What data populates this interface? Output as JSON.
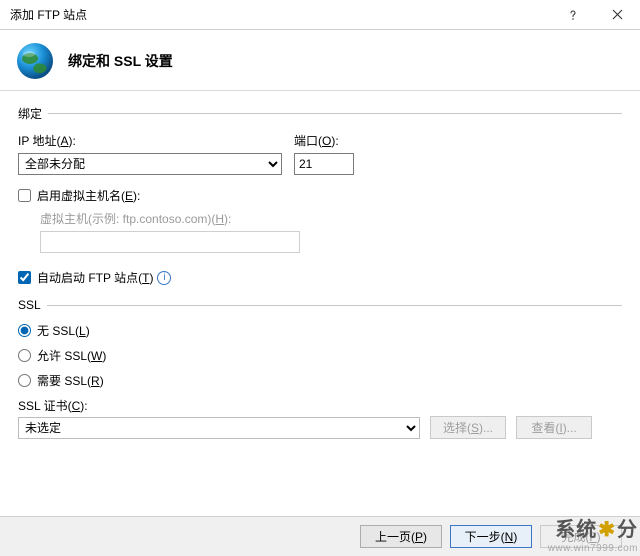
{
  "window": {
    "title": "添加 FTP 站点"
  },
  "header": {
    "title": "绑定和 SSL 设置"
  },
  "binding": {
    "group_label": "绑定",
    "ip_label_pre": "IP 地址(",
    "ip_label_u": "A",
    "ip_label_post": "):",
    "ip_value": "全部未分配",
    "port_label_pre": "端口(",
    "port_label_u": "O",
    "port_label_post": "):",
    "port_value": "21",
    "vhost_label_pre": "启用虚拟主机名(",
    "vhost_label_u": "E",
    "vhost_label_post": "):",
    "vhost_sub_label_pre": "虚拟主机(示例: ftp.contoso.com)(",
    "vhost_sub_label_u": "H",
    "vhost_sub_label_post": "):"
  },
  "autostart": {
    "label_pre": "自动启动 FTP 站点(",
    "label_u": "T",
    "label_post": ")"
  },
  "ssl": {
    "group_label": "SSL",
    "none_pre": "无 SSL(",
    "none_u": "L",
    "none_post": ")",
    "allow_pre": "允许 SSL(",
    "allow_u": "W",
    "allow_post": ")",
    "require_pre": "需要 SSL(",
    "require_u": "R",
    "require_post": ")",
    "cert_label_pre": "SSL 证书(",
    "cert_label_u": "C",
    "cert_label_post": "):",
    "cert_value": "未选定",
    "select_btn_pre": "选择(",
    "select_btn_u": "S",
    "select_btn_post": ")...",
    "view_btn_pre": "查看(",
    "view_btn_u": "I",
    "view_btn_post": ")..."
  },
  "wizard": {
    "prev_pre": "上一页(",
    "prev_u": "P",
    "prev_post": ")",
    "next_pre": "下一步(",
    "next_u": "N",
    "next_post": ")",
    "finish_pre": "完成(",
    "finish_u": "F",
    "finish_post": ")"
  },
  "watermark": {
    "c1": "系",
    "c2": "统",
    "c3": "分",
    "url": "www.win7999.com"
  }
}
